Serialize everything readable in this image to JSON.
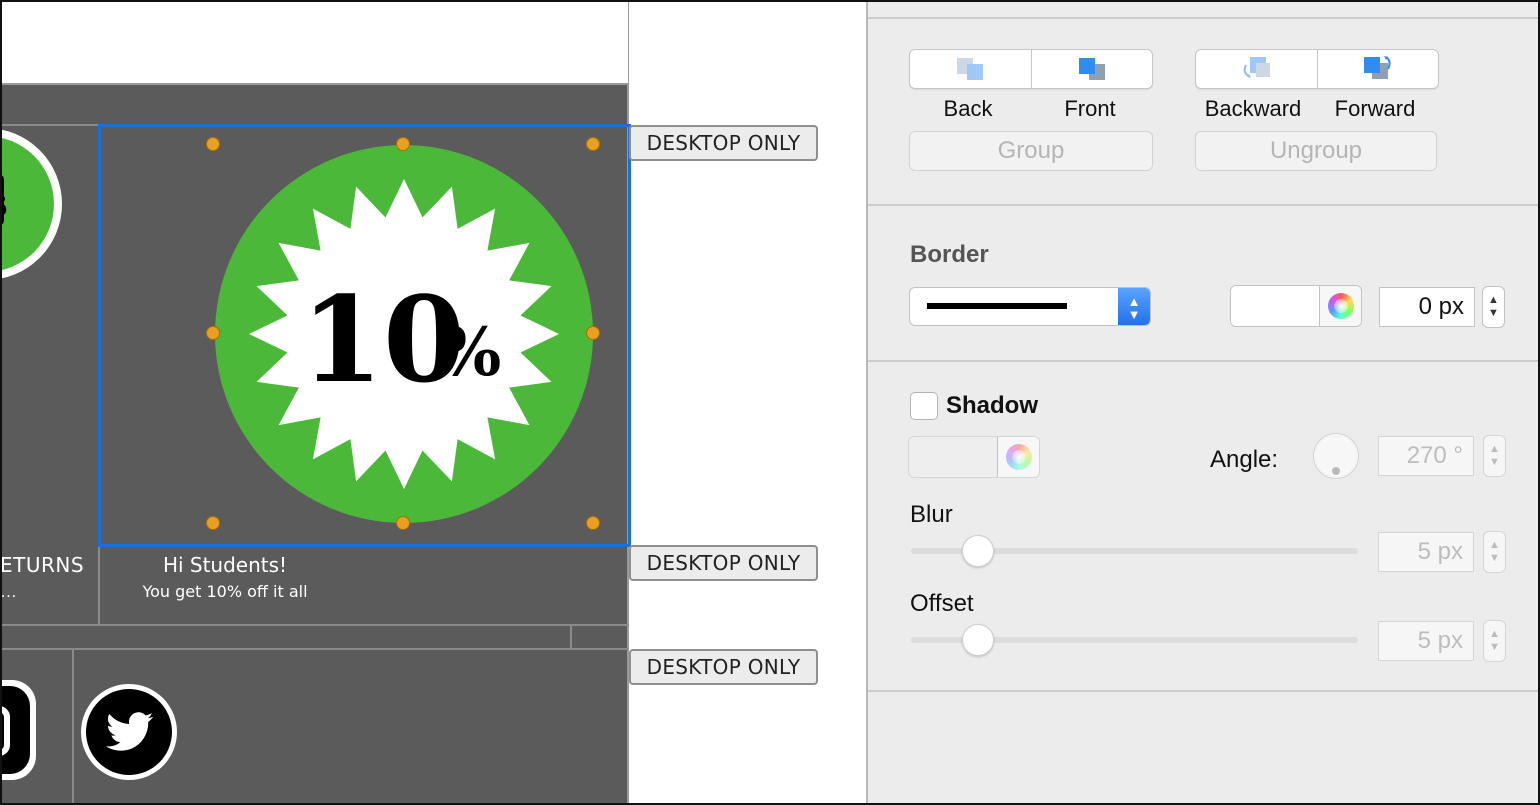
{
  "canvas": {
    "promo": {
      "percent": "10",
      "percent_sign": "%"
    },
    "tile_returns": {
      "title": "ETURNS",
      "subtitle": "…"
    },
    "tile_students": {
      "title": "Hi Students!",
      "subtitle": "You get 10% off it all"
    },
    "badges": [
      "DESKTOP ONLY",
      "DESKTOP ONLY",
      "DESKTOP ONLY"
    ],
    "icons": [
      "calendar-icon",
      "percent-badge-icon",
      "instagram-icon",
      "twitter-icon"
    ],
    "colors": {
      "dark_bg": "#5b5b5b",
      "green": "#4cb83a",
      "selection": "#1a6fd8",
      "handle": "#e8a020"
    }
  },
  "inspector": {
    "arrange": {
      "back_label": "Back",
      "front_label": "Front",
      "backward_label": "Backward",
      "forward_label": "Forward",
      "group_label": "Group",
      "ungroup_label": "Ungroup"
    },
    "border": {
      "title": "Border",
      "style": "solid",
      "width": "0 px"
    },
    "shadow": {
      "title": "Shadow",
      "enabled": false,
      "angle_label": "Angle:",
      "angle_value": "270 °",
      "blur_label": "Blur",
      "blur_value": "5 px",
      "offset_label": "Offset",
      "offset_value": "5 px"
    },
    "colors": {
      "accent": "#1f6fe8",
      "panel_bg": "#ececec"
    }
  }
}
